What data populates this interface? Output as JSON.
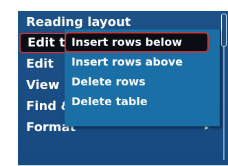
{
  "menu": {
    "items": [
      {
        "label": "Reading layout"
      },
      {
        "label": "Edit ta"
      },
      {
        "label": "Edit"
      },
      {
        "label": "View"
      },
      {
        "label": "Find &"
      },
      {
        "label": "Format",
        "has_submenu": true
      }
    ],
    "submenu_arrow": "▸"
  },
  "submenu": {
    "items": [
      {
        "label": "Insert rows below"
      },
      {
        "label": "Insert rows above"
      },
      {
        "label": "Delete rows"
      },
      {
        "label": "Delete table"
      }
    ]
  },
  "colors": {
    "menu_background": "#1c5186",
    "submenu_background": "#1a6fa7",
    "selection_background": "#0a0e14",
    "selection_border": "#c83838"
  }
}
